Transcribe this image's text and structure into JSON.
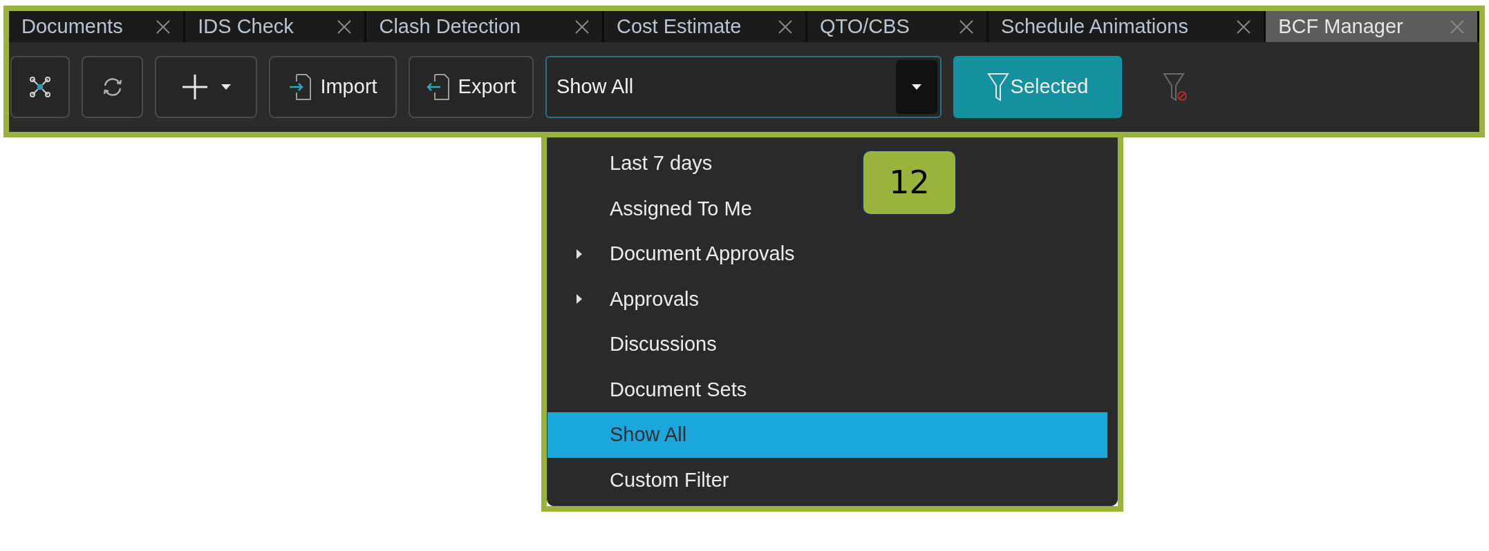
{
  "tabs": [
    {
      "label": "Documents",
      "selected": false
    },
    {
      "label": "IDS Check",
      "selected": false
    },
    {
      "label": "Clash Detection",
      "selected": false
    },
    {
      "label": "Cost Estimate",
      "selected": false
    },
    {
      "label": "QTO/CBS",
      "selected": false
    },
    {
      "label": "Schedule Animations",
      "selected": false
    },
    {
      "label": "BCF Manager",
      "selected": true
    }
  ],
  "toolbar": {
    "import_button": "Import",
    "export_button": "Export",
    "filter_select": {
      "value": "Show All",
      "expanded": true
    },
    "selected_button": "Selected"
  },
  "filter_menu": [
    {
      "label": "Last 7 days",
      "submenu": false,
      "selected": false
    },
    {
      "label": "Assigned To Me",
      "submenu": false,
      "selected": false
    },
    {
      "label": "Document Approvals",
      "submenu": true,
      "selected": false
    },
    {
      "label": "Approvals",
      "submenu": true,
      "selected": false
    },
    {
      "label": "Discussions",
      "submenu": false,
      "selected": false
    },
    {
      "label": "Document Sets",
      "submenu": false,
      "selected": false
    },
    {
      "label": "Show All",
      "submenu": false,
      "selected": true
    },
    {
      "label": "Custom Filter",
      "submenu": false,
      "selected": false
    }
  ],
  "callout_badge": "12"
}
